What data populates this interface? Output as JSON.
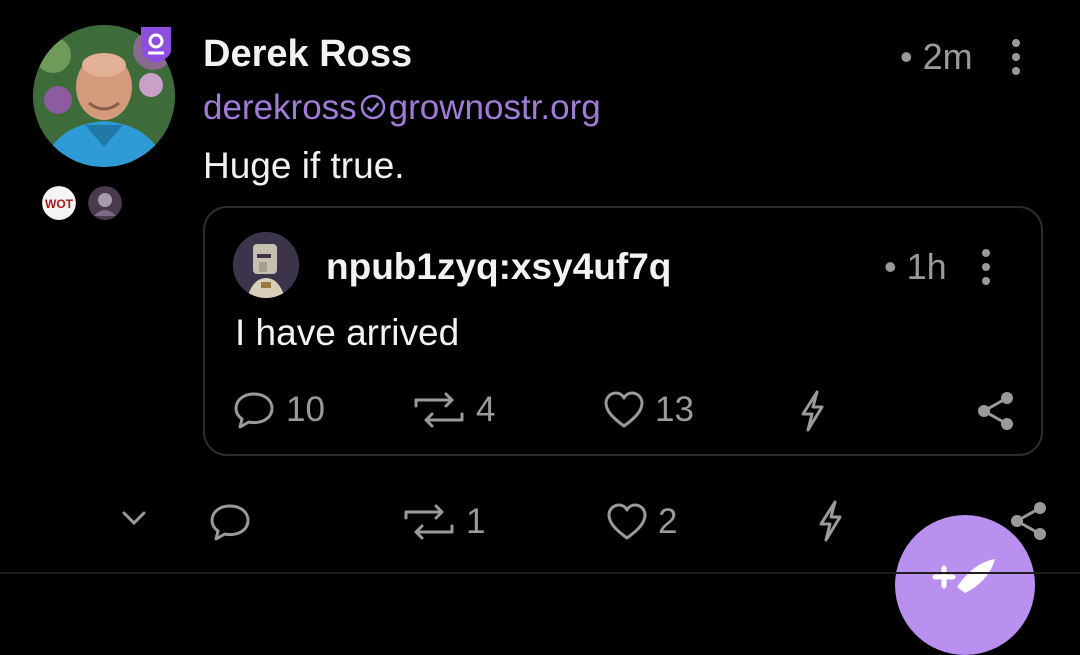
{
  "post": {
    "author_name": "Derek Ross",
    "nip05_user": "derekross",
    "nip05_domain": "grownostr.org",
    "time": "2m",
    "content": "Huge if true.",
    "badge_wot": "WOT",
    "reactions": {
      "replies": "",
      "reposts": "1",
      "likes": "2"
    }
  },
  "quoted": {
    "author_name": "npub1zyq:xsy4uf7q",
    "time": "1h",
    "content": "I have arrived",
    "reactions": {
      "replies": "10",
      "reposts": "4",
      "likes": "13"
    }
  },
  "icons": {
    "badge": "verified-shield-icon",
    "reply": "comment-bubble-icon",
    "repost": "repost-icon",
    "like": "heart-icon",
    "zap": "lightning-icon",
    "share": "share-icon",
    "expand": "chevron-down-icon",
    "compose": "quill-plus-icon"
  },
  "colors": {
    "accent": "#a07cd8",
    "fab": "#b990f0",
    "muted": "#9a9a9a",
    "text": "#f2f2f2",
    "background": "#000000"
  }
}
